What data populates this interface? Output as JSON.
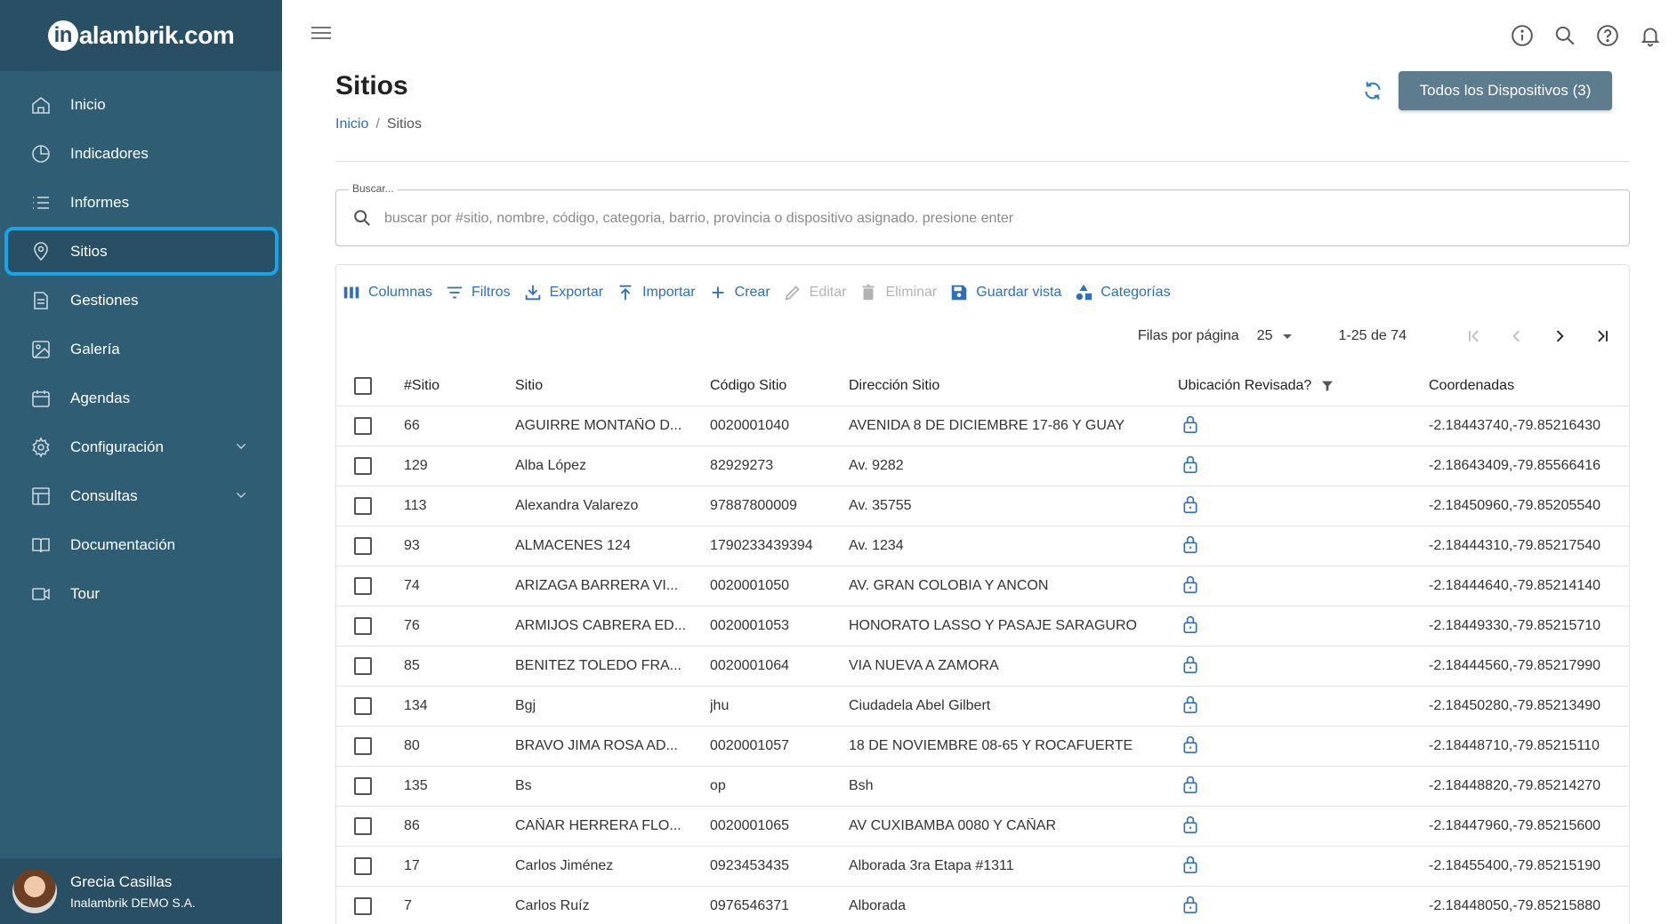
{
  "brand": {
    "logo_text": "alambrik.com",
    "logo_mark": "in"
  },
  "sidebar": {
    "items": [
      {
        "label": "Inicio",
        "icon": "home-icon"
      },
      {
        "label": "Indicadores",
        "icon": "pie-chart-icon"
      },
      {
        "label": "Informes",
        "icon": "list-icon"
      },
      {
        "label": "Sitios",
        "icon": "location-pin-icon",
        "active": true
      },
      {
        "label": "Gestiones",
        "icon": "document-icon"
      },
      {
        "label": "Galería",
        "icon": "image-icon"
      },
      {
        "label": "Agendas",
        "icon": "calendar-icon"
      },
      {
        "label": "Configuración",
        "icon": "gear-icon",
        "expandable": true
      },
      {
        "label": "Consultas",
        "icon": "table-icon",
        "expandable": true
      },
      {
        "label": "Documentación",
        "icon": "book-icon"
      },
      {
        "label": "Tour",
        "icon": "video-icon"
      }
    ],
    "user": {
      "name": "Grecia Casillas",
      "company": "Inalambrik DEMO S.A."
    }
  },
  "header": {
    "title": "Sitios",
    "breadcrumb": {
      "home": "Inicio",
      "current": "Sitios",
      "separator": "/"
    },
    "devices_button": "Todos los Dispositivos (3)"
  },
  "search": {
    "label": "Buscar...",
    "placeholder": "buscar por #sitio, nombre, código, categoria, barrio, provincia o dispositivo asignado. presione enter"
  },
  "toolbar": {
    "columns": "Columnas",
    "filters": "Filtros",
    "export": "Exportar",
    "import": "Importar",
    "create": "Crear",
    "edit": "Editar",
    "delete": "Eliminar",
    "save_view": "Guardar vista",
    "categories": "Categorías"
  },
  "pagination": {
    "rows_label": "Filas por página",
    "rows_value": "25",
    "range": "1-25 de 74"
  },
  "table": {
    "headers": {
      "num": "#Sitio",
      "sitio": "Sitio",
      "codigo": "Código Sitio",
      "direccion": "Dirección Sitio",
      "ubicacion": "Ubicación Revisada?",
      "coordenadas": "Coordenadas"
    },
    "rows": [
      {
        "num": "66",
        "sitio": "AGUIRRE MONTAÑO D...",
        "codigo": "0020001040",
        "direccion": "AVENIDA 8 DE DICIEMBRE 17-86 Y GUAY",
        "coordenadas": "-2.18443740,-79.85216430"
      },
      {
        "num": "129",
        "sitio": "Alba López",
        "codigo": "82929273",
        "direccion": "Av. 9282",
        "coordenadas": "-2.18643409,-79.85566416"
      },
      {
        "num": "113",
        "sitio": "Alexandra Valarezo",
        "codigo": "97887800009",
        "direccion": "Av. 35755",
        "coordenadas": "-2.18450960,-79.85205540"
      },
      {
        "num": "93",
        "sitio": "ALMACENES 124",
        "codigo": "1790233439394",
        "direccion": "Av. 1234",
        "coordenadas": "-2.18444310,-79.85217540"
      },
      {
        "num": "74",
        "sitio": "ARIZAGA BARRERA VI...",
        "codigo": "0020001050",
        "direccion": "AV. GRAN COLOBIA Y ANCON",
        "coordenadas": "-2.18444640,-79.85214140"
      },
      {
        "num": "76",
        "sitio": "ARMIJOS CABRERA ED...",
        "codigo": "0020001053",
        "direccion": "HONORATO LASSO Y PASAJE SARAGURO",
        "coordenadas": "-2.18449330,-79.85215710"
      },
      {
        "num": "85",
        "sitio": "BENITEZ TOLEDO FRA...",
        "codigo": "0020001064",
        "direccion": "VIA NUEVA A ZAMORA",
        "coordenadas": "-2.18444560,-79.85217990"
      },
      {
        "num": "134",
        "sitio": "Bgj",
        "codigo": "jhu",
        "direccion": "Ciudadela Abel Gilbert",
        "coordenadas": "-2.18450280,-79.85213490"
      },
      {
        "num": "80",
        "sitio": "BRAVO JIMA ROSA AD...",
        "codigo": "0020001057",
        "direccion": "18 DE NOVIEMBRE 08-65 Y ROCAFUERTE",
        "coordenadas": "-2.18448710,-79.85215110"
      },
      {
        "num": "135",
        "sitio": "Bs",
        "codigo": "op",
        "direccion": "Bsh",
        "coordenadas": "-2.18448820,-79.85214270"
      },
      {
        "num": "86",
        "sitio": "CAÑAR HERRERA FLO...",
        "codigo": "0020001065",
        "direccion": "AV CUXIBAMBA 0080 Y CAÑAR",
        "coordenadas": "-2.18447960,-79.85215600"
      },
      {
        "num": "17",
        "sitio": "Carlos Jiménez",
        "codigo": "0923453435",
        "direccion": "Alborada 3ra Etapa #1311",
        "coordenadas": "-2.18455400,-79.85215190"
      },
      {
        "num": "7",
        "sitio": "Carlos Ruíz",
        "codigo": "0976546371",
        "direccion": "Alborada",
        "coordenadas": "-2.18448050,-79.85215880"
      }
    ]
  },
  "colors": {
    "sidebar": "#2f5d74",
    "sidebar_dark": "#284f63",
    "accent": "#2f6fb8",
    "active_outline": "#1aa3e8",
    "button": "#5d7c8d"
  }
}
